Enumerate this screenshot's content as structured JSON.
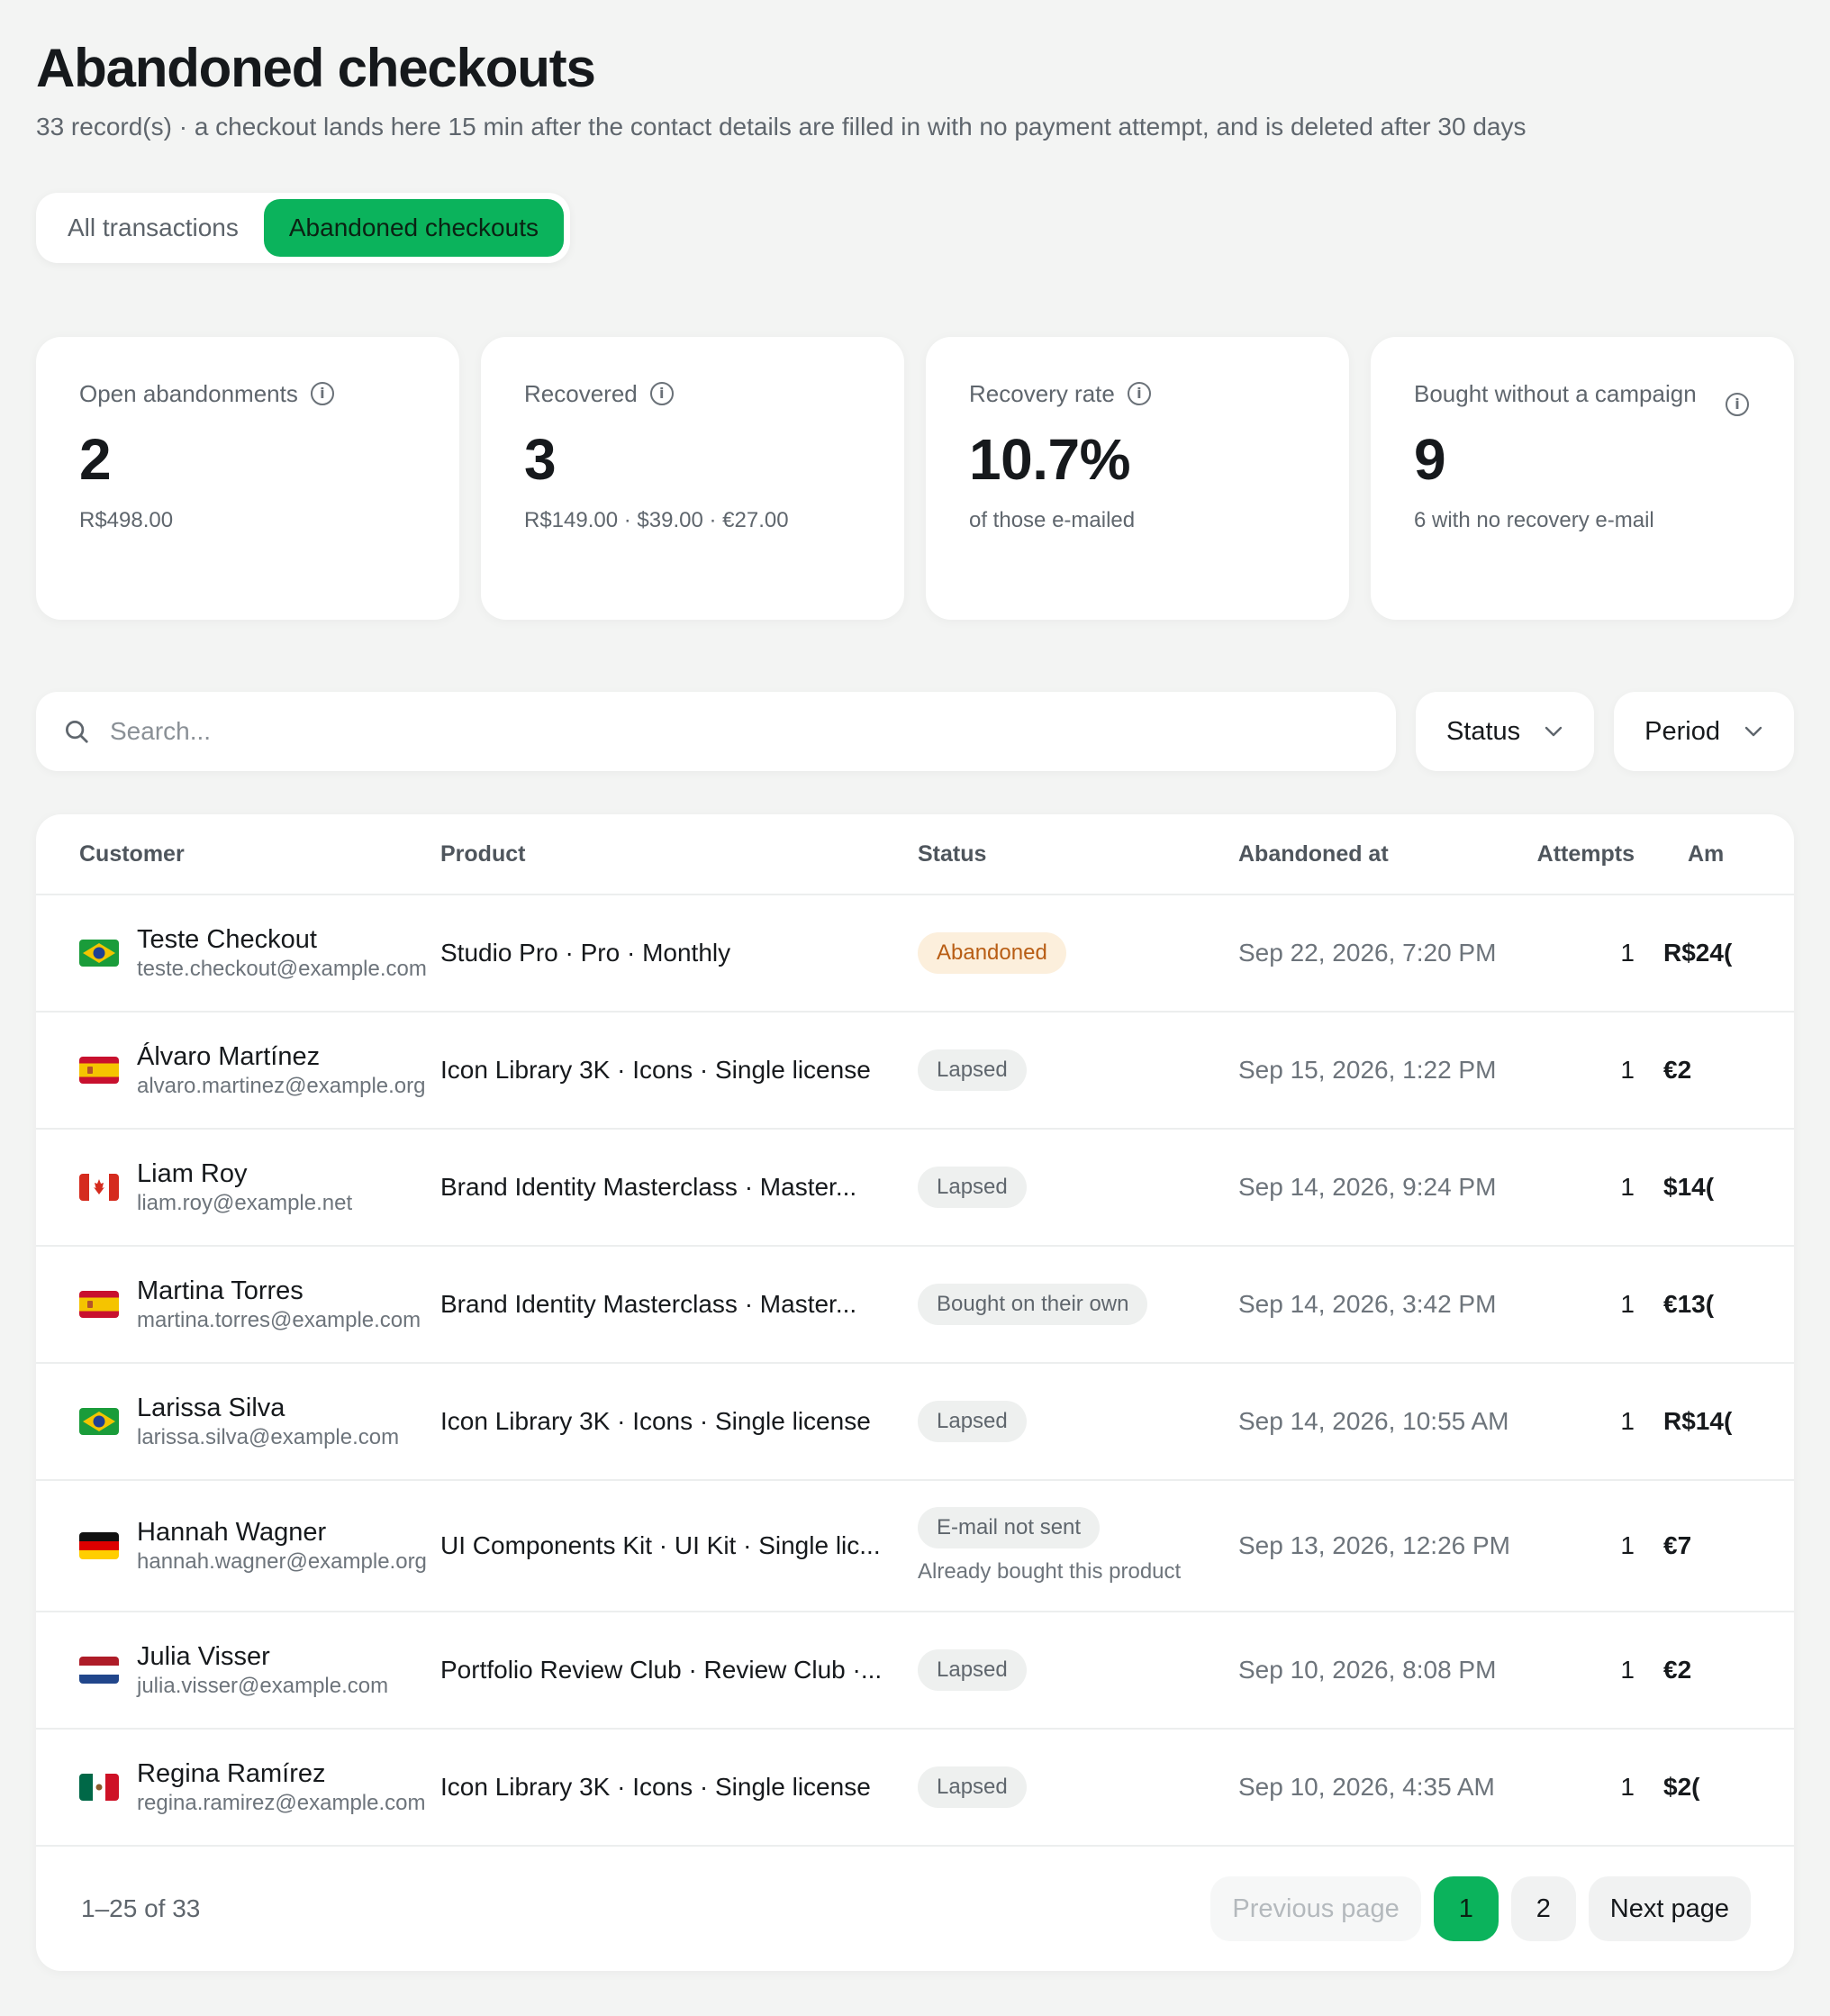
{
  "header": {
    "title": "Abandoned checkouts",
    "subtitle": "33 record(s) · a checkout lands here 15 min after the contact details are filled in with no payment attempt, and is deleted after 30 days"
  },
  "tabs": [
    {
      "label": "All transactions",
      "active": false
    },
    {
      "label": "Abandoned checkouts",
      "active": true
    }
  ],
  "stats": [
    {
      "label": "Open abandonments",
      "value": "2",
      "sub": "R$498.00"
    },
    {
      "label": "Recovered",
      "value": "3",
      "sub": "R$149.00 · $39.00 · €27.00"
    },
    {
      "label": "Recovery rate",
      "value": "10.7%",
      "sub": "of those e-mailed"
    },
    {
      "label": "Bought without a campaign",
      "value": "9",
      "sub": "6 with no recovery e-mail"
    }
  ],
  "filters": {
    "search_placeholder": "Search...",
    "status_label": "Status",
    "period_label": "Period"
  },
  "table": {
    "columns": [
      "Customer",
      "Product",
      "Status",
      "Abandoned at",
      "Attempts",
      "Am"
    ],
    "rows": [
      {
        "country": "br",
        "name": "Teste Checkout",
        "email": "teste.checkout@example.com",
        "product": "Studio Pro · Pro · Monthly",
        "status": "Abandoned",
        "status_type": "abandoned",
        "note": "",
        "date": "Sep 22, 2026, 7:20 PM",
        "attempts": "1",
        "amount": "R$24("
      },
      {
        "country": "es",
        "name": "Álvaro Martínez",
        "email": "alvaro.martinez@example.org",
        "product": "Icon Library 3K · Icons · Single license",
        "status": "Lapsed",
        "status_type": "neutral",
        "note": "",
        "date": "Sep 15, 2026, 1:22 PM",
        "attempts": "1",
        "amount": "€2"
      },
      {
        "country": "ca",
        "name": "Liam Roy",
        "email": "liam.roy@example.net",
        "product": "Brand Identity Masterclass · Master...",
        "status": "Lapsed",
        "status_type": "neutral",
        "note": "",
        "date": "Sep 14, 2026, 9:24 PM",
        "attempts": "1",
        "amount": "$14("
      },
      {
        "country": "es",
        "name": "Martina Torres",
        "email": "martina.torres@example.com",
        "product": "Brand Identity Masterclass · Master...",
        "status": "Bought on their own",
        "status_type": "neutral",
        "note": "",
        "date": "Sep 14, 2026, 3:42 PM",
        "attempts": "1",
        "amount": "€13("
      },
      {
        "country": "br",
        "name": "Larissa Silva",
        "email": "larissa.silva@example.com",
        "product": "Icon Library 3K · Icons · Single license",
        "status": "Lapsed",
        "status_type": "neutral",
        "note": "",
        "date": "Sep 14, 2026, 10:55 AM",
        "attempts": "1",
        "amount": "R$14("
      },
      {
        "country": "de",
        "name": "Hannah Wagner",
        "email": "hannah.wagner@example.org",
        "product": "UI Components Kit · UI Kit · Single lic...",
        "status": "E-mail not sent",
        "status_type": "neutral",
        "note": "Already bought this product",
        "date": "Sep 13, 2026, 12:26 PM",
        "attempts": "1",
        "amount": "€7"
      },
      {
        "country": "nl",
        "name": "Julia Visser",
        "email": "julia.visser@example.com",
        "product": "Portfolio Review Club · Review Club ·...",
        "status": "Lapsed",
        "status_type": "neutral",
        "note": "",
        "date": "Sep 10, 2026, 8:08 PM",
        "attempts": "1",
        "amount": "€2"
      },
      {
        "country": "mx",
        "name": "Regina Ramírez",
        "email": "regina.ramirez@example.com",
        "product": "Icon Library 3K · Icons · Single license",
        "status": "Lapsed",
        "status_type": "neutral",
        "note": "",
        "date": "Sep 10, 2026, 4:35 AM",
        "attempts": "1",
        "amount": "$2("
      }
    ]
  },
  "pagination": {
    "range": "1–25 of 33",
    "prev_label": "Previous page",
    "pages": [
      "1",
      "2"
    ],
    "current": "1",
    "next_label": "Next page"
  },
  "colors": {
    "accent": "#0bb35c",
    "abandoned_bg": "#fcefdc",
    "abandoned_text": "#b85d14"
  }
}
